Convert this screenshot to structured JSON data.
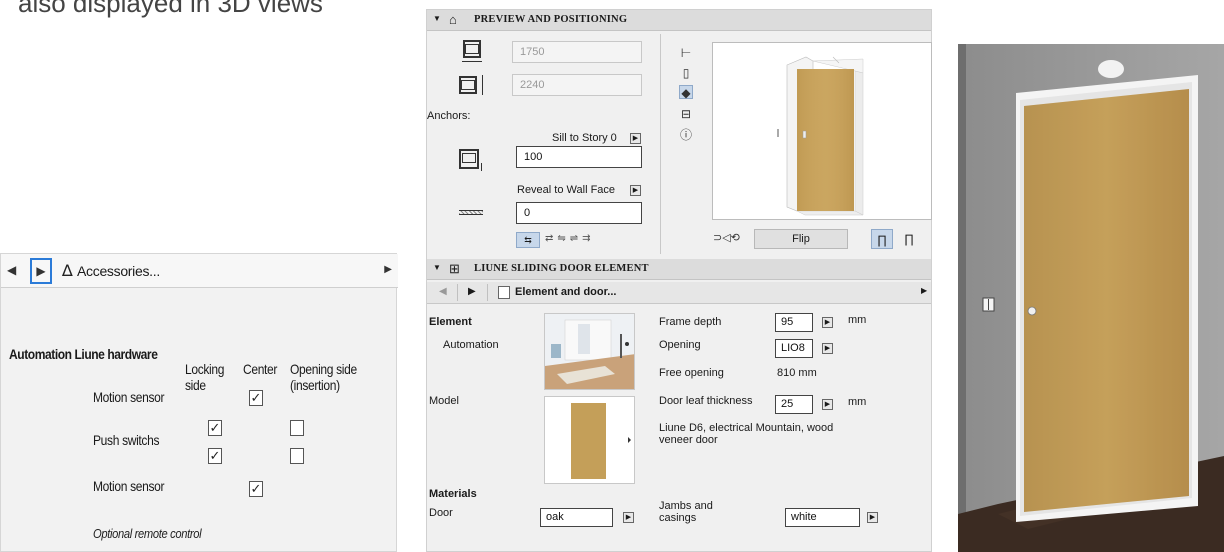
{
  "caption": "also displayed in 3D views",
  "left_panel": {
    "tab_title": "Accessories...",
    "section_title": "Automation Liune hardware",
    "columns": [
      "Locking side",
      "Center",
      "Opening side (insertion)"
    ],
    "rows": [
      {
        "label": "Motion sensor",
        "locking": false,
        "center": true,
        "opening": false
      },
      {
        "label": "Push switchs",
        "locking": true,
        "center": false,
        "opening": true
      },
      {
        "label": "",
        "locking": true,
        "center": false,
        "opening": true
      },
      {
        "label": "Motion sensor",
        "locking": false,
        "center": true,
        "opening": false
      }
    ],
    "note": "Optional remote control"
  },
  "preview": {
    "header": "PREVIEW AND POSITIONING",
    "width_value": "1750",
    "height_value": "2240",
    "anchors_label": "Anchors:",
    "sill_label": "Sill to Story 0",
    "sill_value": "100",
    "reveal_label": "Reveal to Wall Face",
    "reveal_value": "0",
    "flip_label": "Flip"
  },
  "element_section": {
    "header": "LIUNE SLIDING DOOR ELEMENT",
    "tab_title": "Element and door...",
    "element_label": "Element",
    "automation_label": "Automation",
    "model_label": "Model",
    "frame_depth_label": "Frame depth",
    "frame_depth_value": "95",
    "frame_depth_unit": "mm",
    "opening_label": "Opening",
    "opening_value": "LIO8",
    "free_opening_label": "Free opening",
    "free_opening_value": "810 mm",
    "leaf_thickness_label": "Door leaf thickness",
    "leaf_thickness_value": "25",
    "leaf_thickness_unit": "mm",
    "model_description": "Liune D6, electrical Mountain, wood veneer door",
    "materials_label": "Materials",
    "door_label": "Door",
    "door_material": "oak",
    "jambs_label": "Jambs and casings",
    "jambs_material": "white"
  },
  "colors": {
    "accent": "#2b7bd8",
    "oak": "#c9a45e",
    "selection": "#c7d7ea"
  }
}
